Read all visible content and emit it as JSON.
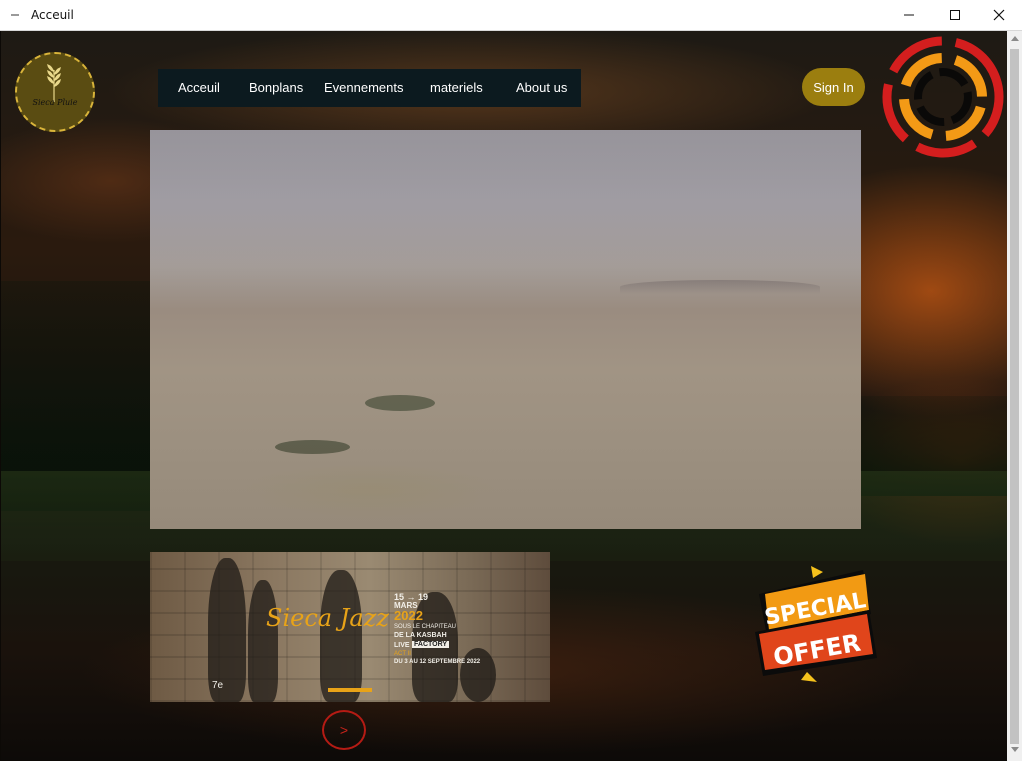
{
  "window": {
    "title": "Acceuil"
  },
  "nav": {
    "items": [
      {
        "label": "Acceuil"
      },
      {
        "label": "Bonplans"
      },
      {
        "label": "Evennements"
      },
      {
        "label": "materiels"
      },
      {
        "label": "About us"
      }
    ]
  },
  "header": {
    "signin_label": "Sign In",
    "logo_text": "Sieca Pluie"
  },
  "event_banner": {
    "brand": "Sieca Jazz",
    "dates": "15 → 19",
    "month": "MARS",
    "year": "2022",
    "venue_line1": "SOUS LE CHAPITEAU",
    "venue_line2": "DE LA KASBAH",
    "live": "LIVE",
    "factory": "FACTORY",
    "act": "ACT II",
    "second_dates": "DU 3 AU 12 SEPTEMBRE 2022",
    "edition": "7e"
  },
  "carousel": {
    "next_label": ">"
  },
  "promo": {
    "line1": "SPECIAL",
    "line2": "OFFER"
  },
  "colors": {
    "nav_bg": "#0c1a1f",
    "signin_bg": "#9b7e0f",
    "accent_red": "#c9231a",
    "offer_orange": "#f29a13",
    "offer_red": "#e0451b"
  }
}
